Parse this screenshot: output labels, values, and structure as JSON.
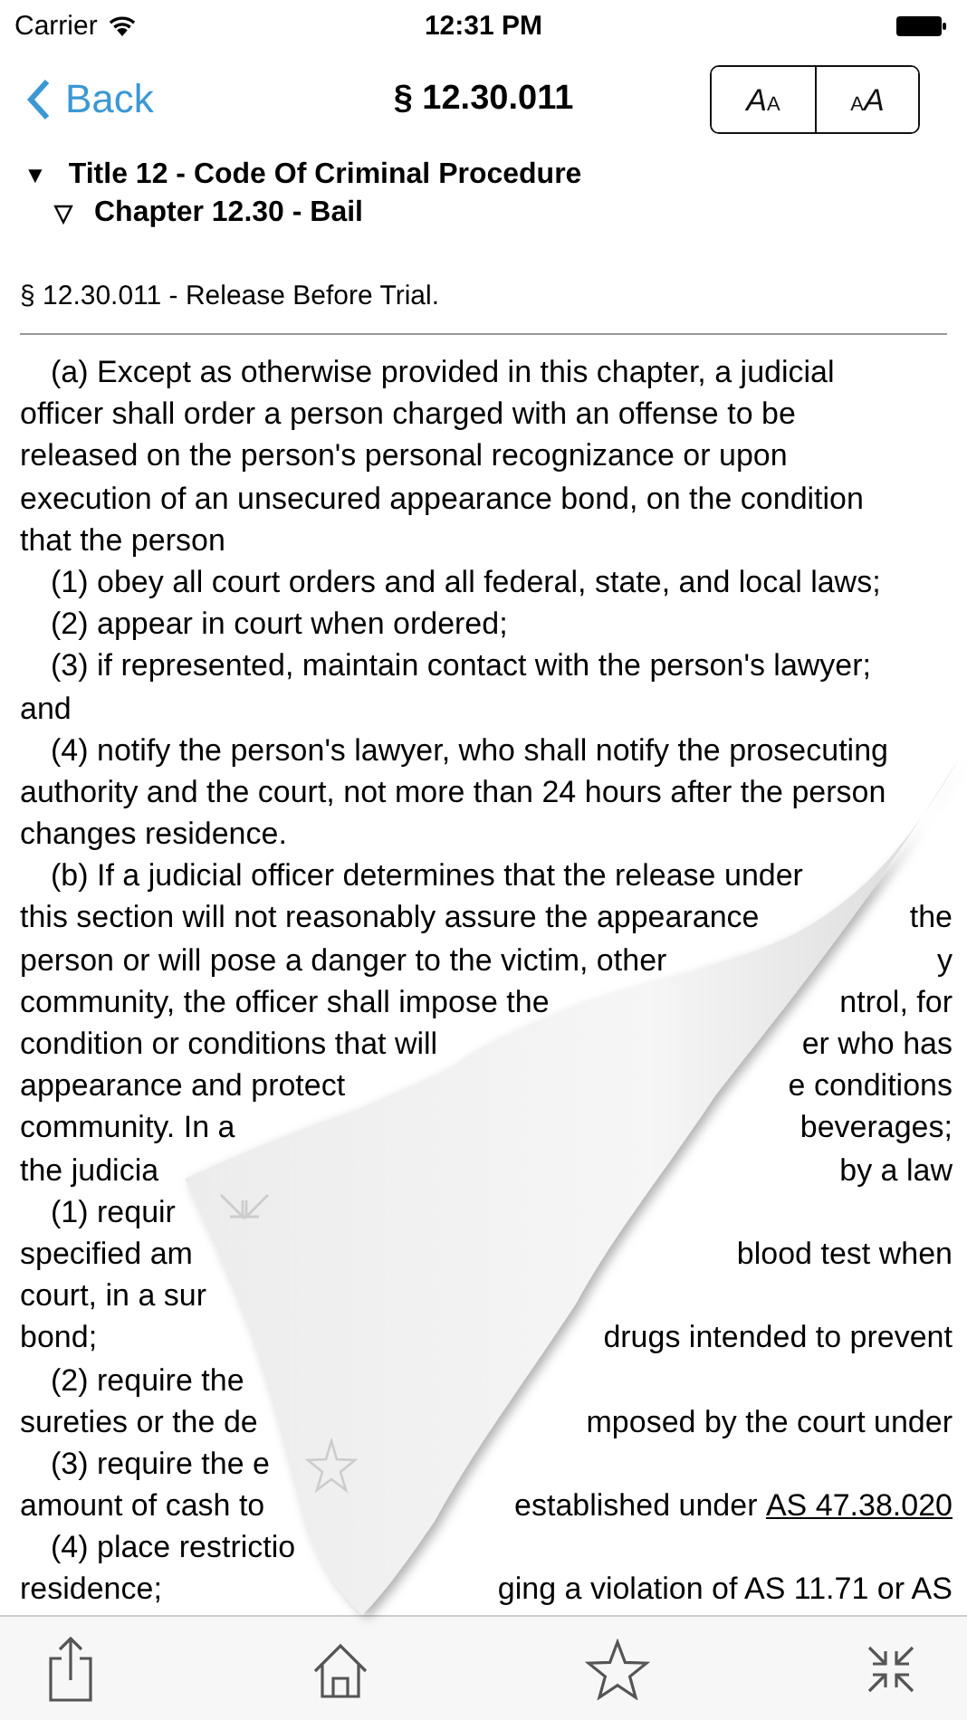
{
  "status_bar": {
    "carrier": "Carrier",
    "time": "12:31 PM"
  },
  "nav": {
    "back": "Back",
    "title": "§ 12.30.011",
    "font_buttons": [
      {
        "label": "AA",
        "kind": "decrease"
      },
      {
        "label": "AA",
        "kind": "increase"
      }
    ]
  },
  "outline": [
    {
      "marker": "▼",
      "label": "Title 12 - Code Of Criminal Procedure",
      "children": [
        {
          "marker": "▽",
          "label": "Chapter 12.30 - Bail"
        }
      ]
    }
  ],
  "section_heading": "§ 12.30.011 - Release Before Trial.",
  "lines": [
    {
      "indent": true,
      "left": "(a) Except as otherwise provided in this chapter, a judicial"
    },
    {
      "indent": false,
      "left": "officer shall order a person charged with an offense to be"
    },
    {
      "indent": false,
      "left": "released on the person's personal recognizance or upon"
    },
    {
      "indent": false,
      "left": "execution of an unsecured appearance bond, on the condition"
    },
    {
      "indent": false,
      "left": "that the person"
    },
    {
      "indent": true,
      "left": "(1) obey all court orders and all federal, state, and local laws;"
    },
    {
      "indent": true,
      "left": "(2) appear in court when ordered;"
    },
    {
      "indent": true,
      "left": "(3) if represented, maintain contact with the person's lawyer;"
    },
    {
      "indent": false,
      "left": "and"
    },
    {
      "indent": true,
      "left": "(4) notify the person's lawyer, who shall notify the prosecuting"
    },
    {
      "indent": false,
      "left": "authority and the court, not more than 24 hours after the person"
    },
    {
      "indent": false,
      "left": "changes residence."
    },
    {
      "indent": true,
      "left": "(b) If a judicial officer determines that the release under"
    },
    {
      "indent": false,
      "left": "this section will not reasonably assure the appearance",
      "right": "the"
    },
    {
      "indent": false,
      "left": "person or will pose a danger to the victim, other",
      "right": "y"
    },
    {
      "indent": false,
      "left": "community, the officer shall impose the",
      "right": "ntrol, for"
    },
    {
      "indent": false,
      "left": "condition or conditions that will",
      "right": "er who has"
    },
    {
      "indent": false,
      "left": "appearance and protect",
      "right": "e conditions"
    },
    {
      "indent": false,
      "left": "community. In a",
      "right": "beverages;"
    },
    {
      "indent": false,
      "left": "the judicia",
      "right": "by a law"
    },
    {
      "indent": true,
      "left": "(1) requir"
    },
    {
      "indent": false,
      "left": "specified am",
      "right": "blood test when"
    },
    {
      "indent": false,
      "left": "court, in a sur"
    },
    {
      "indent": false,
      "left": "bond;",
      "right": "drugs intended to prevent"
    },
    {
      "indent": true,
      "left": "(2) require the"
    },
    {
      "indent": false,
      "left": "sureties or the de",
      "right": "mposed by the court under"
    },
    {
      "indent": true,
      "left": "(3) require the e"
    },
    {
      "indent": false,
      "left": "amount of cash to",
      "right": "established under ",
      "link": "AS 47.38.020"
    },
    {
      "indent": true,
      "left": "(4) place restrictio"
    },
    {
      "indent": false,
      "left": "residence;",
      "right": "ging a violation of AS 11.71 or AS"
    }
  ]
}
